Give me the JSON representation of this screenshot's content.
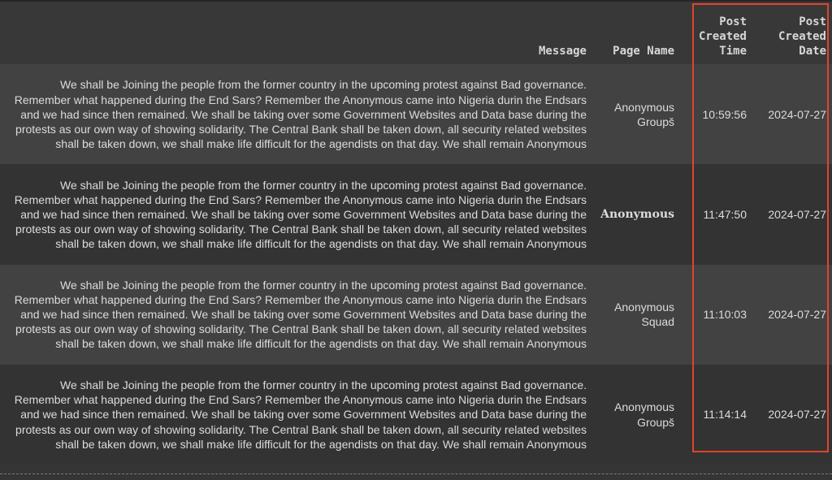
{
  "table": {
    "columns": [
      "Message",
      "Page Name",
      "Post\nCreated\nTime",
      "Post\nCreated\nDate"
    ],
    "column_header_lines": {
      "time": [
        "Post",
        "Created",
        "Time"
      ],
      "date": [
        "Post",
        "Created",
        "Date"
      ]
    },
    "rows": [
      {
        "message": "We shall be Joining the people from the former country in the upcoming protest against Bad governance. Remember what happened during the End Sars? Remember the Anonymous came into Nigeria durin the Endsars and we had since then remained. We shall be taking over some Government Websites and Data base during the protests as our own way of showing solidarity. The Central Bank shall be taken down, all security related websites shall be taken down, we shall make life difficult for the agendists on that day. We shall remain Anonymous",
        "page_name": "Anonymous Groupš",
        "time": "10:59:56",
        "date": "2024-07-27"
      },
      {
        "message": "We shall be Joining the people from the former country in the upcoming protest against Bad governance. Remember what happened during the End Sars? Remember the Anonymous came into Nigeria durin the Endsars and we had since then remained. We shall be taking over some Government Websites and Data base during the protests as our own way of showing solidarity. The Central Bank shall be taken down, all security related websites shall be taken down, we shall make life difficult for the agendists on that day. We shall remain Anonymous",
        "page_name": "Anonymous",
        "time": "11:47:50",
        "date": "2024-07-27"
      },
      {
        "message": "We shall be Joining the people from the former country in the upcoming protest against Bad governance. Remember what happened during the End Sars? Remember the Anonymous came into Nigeria durin the Endsars and we had since then remained. We shall be taking over some Government Websites and Data base during the protests as our own way of showing solidarity. The Central Bank shall be taken down, all security related websites shall be taken down, we shall make life difficult for the agendists on that day. We shall remain Anonymous",
        "page_name": "Anonymous Squad",
        "time": "11:10:03",
        "date": "2024-07-27"
      },
      {
        "message": "We shall be Joining the people from the former country in the upcoming protest against Bad governance. Remember what happened during the End Sars? Remember the Anonymous came into Nigeria durin the Endsars and we had since then remained. We shall be taking over some Government Websites and Data base during the protests as our own way of showing solidarity. The Central Bank shall be taken down, all security related websites shall be taken down, we shall make life difficult for the agendists on that day. We shall remain Anonymous",
        "page_name": "Anonymous Groupš",
        "time": "11:14:14",
        "date": "2024-07-27"
      }
    ]
  },
  "colors": {
    "highlight": "#e0432b",
    "header_bg": "#383838",
    "row_odd_bg": "#424242",
    "row_even_bg": "#333333",
    "text": "#dcdcdc"
  }
}
